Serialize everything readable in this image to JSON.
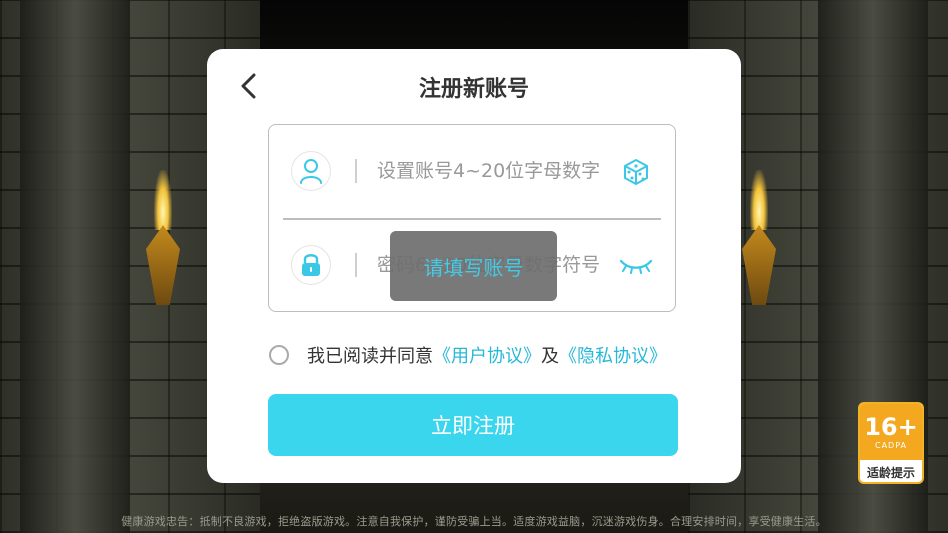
{
  "dialog": {
    "title": "注册新账号",
    "account_placeholder": "设置账号4~20位字母数字",
    "password_placeholder": "密码6~20位字母数字符号",
    "agree_prefix": "我已阅读并同意",
    "user_agreement": "《用户协议》",
    "and_text": "及",
    "privacy_agreement": "《隐私协议》",
    "submit_label": "立即注册"
  },
  "toast": {
    "text": "请填写账号"
  },
  "age_badge": {
    "age": "16+",
    "org": "CADPA",
    "tip": "适龄提示"
  },
  "footer": {
    "text": "健康游戏忠告：抵制不良游戏，拒绝盗版游戏。注意自我保护，谨防受骗上当。适度游戏益脑，沉迷游戏伤身。合理安排时间，享受健康生活。"
  },
  "colors": {
    "accent": "#3ad6ee",
    "link": "#27b8d8",
    "badge": "#f3a81f"
  },
  "icons": [
    "back-arrow-icon",
    "user-icon",
    "dice-icon",
    "lock-icon",
    "eye-closed-icon"
  ]
}
